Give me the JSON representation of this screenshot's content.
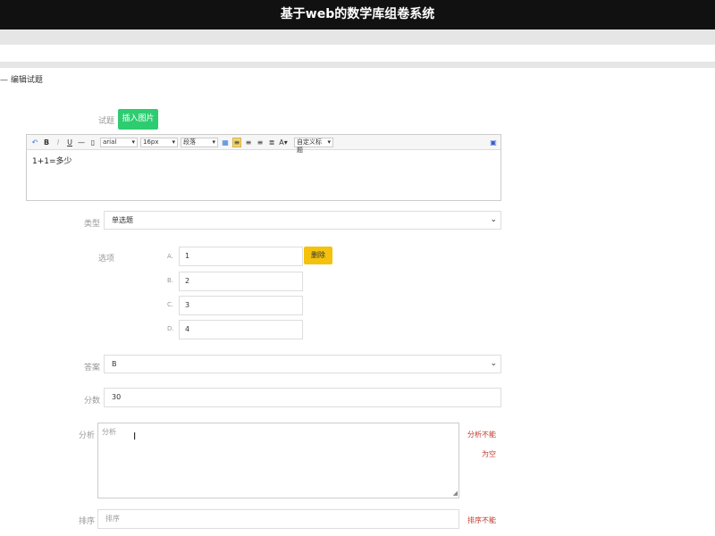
{
  "header": {
    "title": "基于web的数学库组卷系统"
  },
  "section": {
    "title": "— 编辑试题"
  },
  "question": {
    "label": "试题",
    "insert_image_label": "插入图片",
    "content": "1+1=多少"
  },
  "toolbar": {
    "font": "arial",
    "size": "16px",
    "paragraph": "段落",
    "custom_title": "自定义标题"
  },
  "type": {
    "label": "类型",
    "value": "单选题"
  },
  "options": {
    "label": "选项",
    "delete_label": "删除",
    "items": [
      {
        "letter": "A.",
        "value": "1"
      },
      {
        "letter": "B.",
        "value": "2"
      },
      {
        "letter": "C.",
        "value": "3"
      },
      {
        "letter": "D.",
        "value": "4"
      }
    ]
  },
  "answer": {
    "label": "答案",
    "value": "B"
  },
  "score": {
    "label": "分数",
    "value": "30"
  },
  "analysis": {
    "label": "分析",
    "placeholder": "分析",
    "error_line1": "分析不能",
    "error_line2": "为空"
  },
  "order": {
    "label": "排序",
    "placeholder": "排序",
    "error": "排序不能"
  }
}
